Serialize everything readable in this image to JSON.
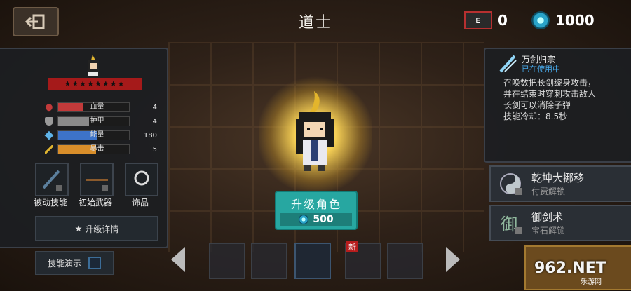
{
  "header": {
    "title": "道士",
    "e_icon_text": "E",
    "e_count": "0",
    "gem_count": "1000"
  },
  "stats": {
    "stars": "★★★★★★★★",
    "items": [
      {
        "label": "血量",
        "value": "4",
        "color": "#c23a3a",
        "fill_pct": 100
      },
      {
        "label": "护甲",
        "value": "4",
        "color": "#8a8a8a",
        "fill_pct": 100
      },
      {
        "label": "能量",
        "value": "180",
        "color": "#3d73c9",
        "fill_pct": 100
      },
      {
        "label": "暴击",
        "value": "5",
        "color": "#d98e2a",
        "fill_pct": 100
      }
    ],
    "slots": {
      "passive": "被动技能",
      "weapon": "初始武器",
      "accessory": "饰品"
    },
    "upgrade_detail": "升级详情"
  },
  "demo_label": "技能演示",
  "upgrade": {
    "label": "升级角色",
    "cost": "500"
  },
  "skill": {
    "name": "万剑归宗",
    "status": "已在使用中",
    "desc": "召唤数把长剑绕身攻击，\n并在结束时穿刺攻击敌人\n长剑可以消除子弹\n技能冷却：8.5秒"
  },
  "locked_skills": [
    {
      "name": "乾坤大挪移",
      "unlock": "付费解锁"
    },
    {
      "name": "御剑术",
      "unlock": "宝石解锁"
    }
  ],
  "badge_new": "新",
  "watermark": {
    "main": "962.NET",
    "sub": "乐游网"
  },
  "colors": {
    "accent_teal": "#27a7a1",
    "ribbon_red": "#a51a1a",
    "status_blue": "#46a6e6"
  }
}
